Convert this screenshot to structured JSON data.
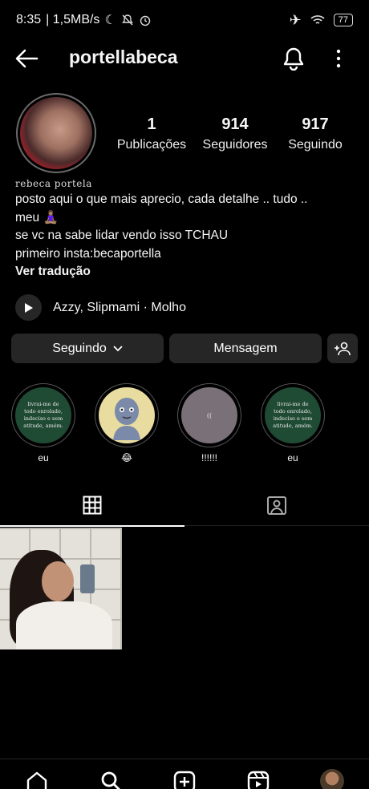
{
  "status_bar": {
    "time": "8:35",
    "speed": "| 1,5MB/s",
    "battery": "77"
  },
  "top_bar": {
    "username": "portellabeca"
  },
  "stats": [
    {
      "value": "1",
      "label": "Publicações"
    },
    {
      "value": "914",
      "label": "Seguidores"
    },
    {
      "value": "917",
      "label": "Seguindo"
    }
  ],
  "bio": {
    "name": "rebeca portela",
    "lines": [
      "posto aqui o que mais aprecio, cada detalhe .. tudo ..",
      "meu 🧘🏽‍♀️",
      "se vc na sabe lidar vendo isso TCHAU",
      "primeiro insta:becaportella"
    ],
    "translate": "Ver tradução"
  },
  "music": {
    "text": "Azzy, Slipmami · Molho"
  },
  "buttons": {
    "following": "Seguindo",
    "message": "Mensagem"
  },
  "highlights": [
    {
      "label": "eu",
      "cover_text": "livrai-me de todo enrolado, indeciso e sem atitude, amém.",
      "bg": "#1f4a34"
    },
    {
      "label": "😂",
      "cover_text": "",
      "bg": "#e8dca0"
    },
    {
      "label": "!!!!!!",
      "cover_text": "((",
      "bg": "#7a7078"
    },
    {
      "label": "eu",
      "cover_text": "livrai-me de todo enrolado, indeciso e sem atitude, amém.",
      "bg": "#1f4a34"
    }
  ]
}
